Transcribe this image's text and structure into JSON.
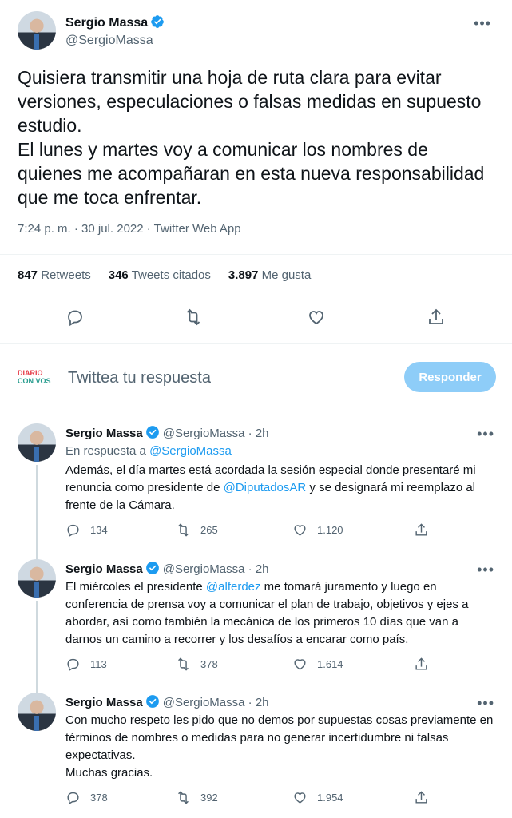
{
  "main_tweet": {
    "name": "Sergio Massa",
    "handle": "@SergioMassa",
    "text": "Quisiera transmitir una hoja de ruta clara para evitar versiones, especulaciones o falsas medidas en supuesto estudio.\nEl lunes y martes voy a comunicar los nombres de quienes me acompañaran en esta nueva responsabilidad que me toca enfrentar.",
    "meta": "7:24 p. m. · 30 jul. 2022 · Twitter Web App",
    "stats": {
      "retweets_count": "847",
      "retweets_label": "Retweets",
      "quotes_count": "346",
      "quotes_label": "Tweets citados",
      "likes_count": "3.897",
      "likes_label": "Me gusta"
    }
  },
  "reply_box": {
    "logo_line1": "DIARIO",
    "logo_line2": "CON VOS",
    "placeholder": "Twittea tu respuesta",
    "button": "Responder"
  },
  "thread": [
    {
      "name": "Sergio Massa",
      "handle": "@SergioMassa · 2h",
      "reply_prefix": "En respuesta a ",
      "reply_to": "@SergioMassa",
      "text_parts": [
        "Además, el día martes está acordada la sesión especial donde presentaré mi renuncia como presidente de ",
        "@DiputadosAR",
        " y se designará mi reemplazo al frente de la Cámara."
      ],
      "replies": "134",
      "retweets": "265",
      "likes": "1.120"
    },
    {
      "name": "Sergio Massa",
      "handle": "@SergioMassa · 2h",
      "text_parts": [
        "El miércoles el presidente ",
        "@alferdez",
        " me tomará juramento y luego en conferencia de prensa voy a comunicar el plan de trabajo, objetivos y ejes a abordar, así como también la mecánica de los primeros 10 días que van a darnos un camino a recorrer y los desafíos a encarar como país."
      ],
      "replies": "113",
      "retweets": "378",
      "likes": "1.614"
    },
    {
      "name": "Sergio Massa",
      "handle": "@SergioMassa · 2h",
      "text": "Con mucho respeto les pido que no demos por supuestas cosas previamente en términos de nombres o medidas para no generar incertidumbre ni falsas expectativas.\nMuchas gracias.",
      "replies": "378",
      "retweets": "392",
      "likes": "1.954"
    }
  ],
  "colors": {
    "accent": "#1d9bf0",
    "button_disabled": "#8ecdf8",
    "muted": "#536471"
  }
}
